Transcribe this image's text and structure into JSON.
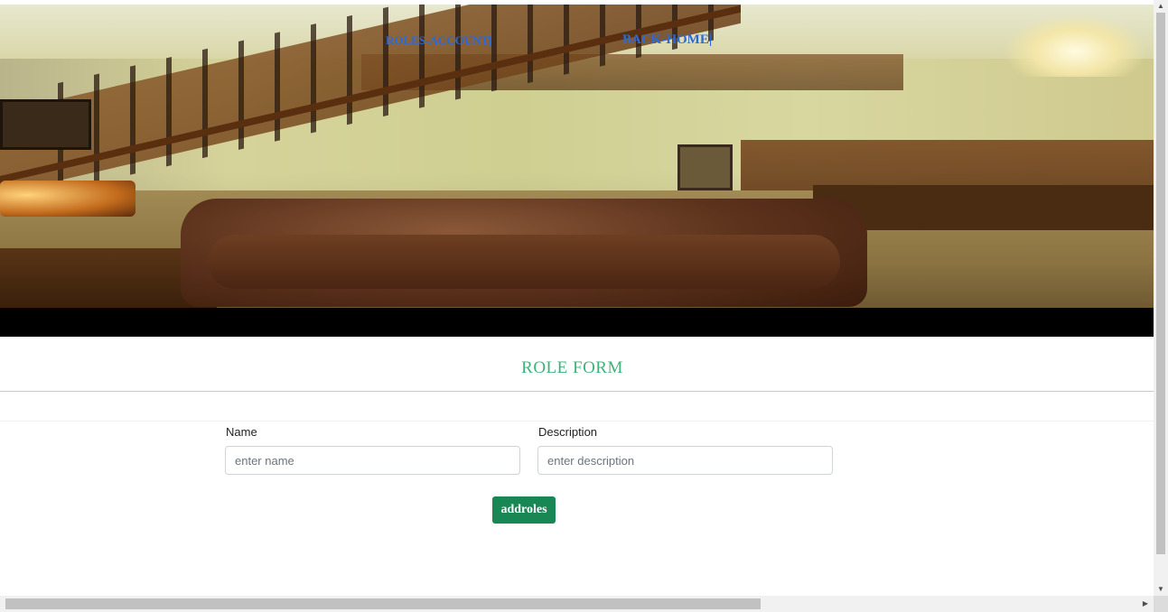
{
  "nav": {
    "roles_account": "ROLES-ACCOUNT|",
    "back_home": "BACK-HOME|"
  },
  "form": {
    "title": "ROLE FORM",
    "name_label": "Name",
    "name_placeholder": "enter name",
    "name_value": "",
    "description_label": "Description",
    "description_placeholder": "enter description",
    "description_value": "",
    "submit_label": "addroles"
  },
  "colors": {
    "title_green": "#3fb27a",
    "button_green": "#198754",
    "nav_blue": "#2a6ad8"
  },
  "icons": {
    "scroll_up": "triangle-up-icon",
    "scroll_down": "triangle-down-icon",
    "scroll_right": "triangle-right-icon"
  }
}
